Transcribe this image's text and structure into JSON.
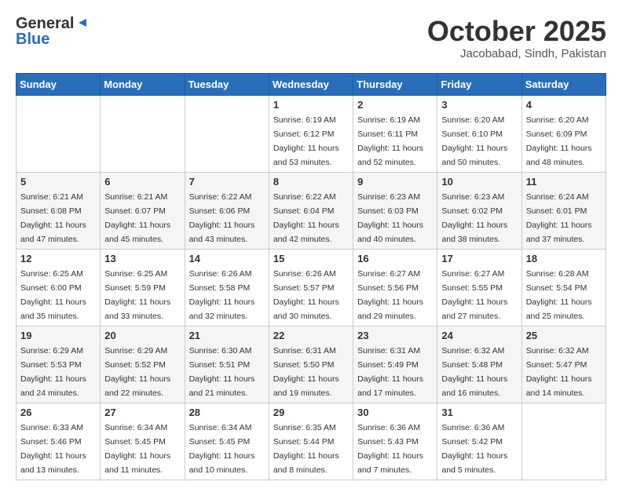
{
  "header": {
    "logo_general": "General",
    "logo_blue": "Blue",
    "month_title": "October 2025",
    "location": "Jacobabad, Sindh, Pakistan"
  },
  "weekdays": [
    "Sunday",
    "Monday",
    "Tuesday",
    "Wednesday",
    "Thursday",
    "Friday",
    "Saturday"
  ],
  "weeks": [
    [
      {
        "day": "",
        "info": ""
      },
      {
        "day": "",
        "info": ""
      },
      {
        "day": "",
        "info": ""
      },
      {
        "day": "1",
        "info": "Sunrise: 6:19 AM\nSunset: 6:12 PM\nDaylight: 11 hours\nand 53 minutes."
      },
      {
        "day": "2",
        "info": "Sunrise: 6:19 AM\nSunset: 6:11 PM\nDaylight: 11 hours\nand 52 minutes."
      },
      {
        "day": "3",
        "info": "Sunrise: 6:20 AM\nSunset: 6:10 PM\nDaylight: 11 hours\nand 50 minutes."
      },
      {
        "day": "4",
        "info": "Sunrise: 6:20 AM\nSunset: 6:09 PM\nDaylight: 11 hours\nand 48 minutes."
      }
    ],
    [
      {
        "day": "5",
        "info": "Sunrise: 6:21 AM\nSunset: 6:08 PM\nDaylight: 11 hours\nand 47 minutes."
      },
      {
        "day": "6",
        "info": "Sunrise: 6:21 AM\nSunset: 6:07 PM\nDaylight: 11 hours\nand 45 minutes."
      },
      {
        "day": "7",
        "info": "Sunrise: 6:22 AM\nSunset: 6:06 PM\nDaylight: 11 hours\nand 43 minutes."
      },
      {
        "day": "8",
        "info": "Sunrise: 6:22 AM\nSunset: 6:04 PM\nDaylight: 11 hours\nand 42 minutes."
      },
      {
        "day": "9",
        "info": "Sunrise: 6:23 AM\nSunset: 6:03 PM\nDaylight: 11 hours\nand 40 minutes."
      },
      {
        "day": "10",
        "info": "Sunrise: 6:23 AM\nSunset: 6:02 PM\nDaylight: 11 hours\nand 38 minutes."
      },
      {
        "day": "11",
        "info": "Sunrise: 6:24 AM\nSunset: 6:01 PM\nDaylight: 11 hours\nand 37 minutes."
      }
    ],
    [
      {
        "day": "12",
        "info": "Sunrise: 6:25 AM\nSunset: 6:00 PM\nDaylight: 11 hours\nand 35 minutes."
      },
      {
        "day": "13",
        "info": "Sunrise: 6:25 AM\nSunset: 5:59 PM\nDaylight: 11 hours\nand 33 minutes."
      },
      {
        "day": "14",
        "info": "Sunrise: 6:26 AM\nSunset: 5:58 PM\nDaylight: 11 hours\nand 32 minutes."
      },
      {
        "day": "15",
        "info": "Sunrise: 6:26 AM\nSunset: 5:57 PM\nDaylight: 11 hours\nand 30 minutes."
      },
      {
        "day": "16",
        "info": "Sunrise: 6:27 AM\nSunset: 5:56 PM\nDaylight: 11 hours\nand 29 minutes."
      },
      {
        "day": "17",
        "info": "Sunrise: 6:27 AM\nSunset: 5:55 PM\nDaylight: 11 hours\nand 27 minutes."
      },
      {
        "day": "18",
        "info": "Sunrise: 6:28 AM\nSunset: 5:54 PM\nDaylight: 11 hours\nand 25 minutes."
      }
    ],
    [
      {
        "day": "19",
        "info": "Sunrise: 6:29 AM\nSunset: 5:53 PM\nDaylight: 11 hours\nand 24 minutes."
      },
      {
        "day": "20",
        "info": "Sunrise: 6:29 AM\nSunset: 5:52 PM\nDaylight: 11 hours\nand 22 minutes."
      },
      {
        "day": "21",
        "info": "Sunrise: 6:30 AM\nSunset: 5:51 PM\nDaylight: 11 hours\nand 21 minutes."
      },
      {
        "day": "22",
        "info": "Sunrise: 6:31 AM\nSunset: 5:50 PM\nDaylight: 11 hours\nand 19 minutes."
      },
      {
        "day": "23",
        "info": "Sunrise: 6:31 AM\nSunset: 5:49 PM\nDaylight: 11 hours\nand 17 minutes."
      },
      {
        "day": "24",
        "info": "Sunrise: 6:32 AM\nSunset: 5:48 PM\nDaylight: 11 hours\nand 16 minutes."
      },
      {
        "day": "25",
        "info": "Sunrise: 6:32 AM\nSunset: 5:47 PM\nDaylight: 11 hours\nand 14 minutes."
      }
    ],
    [
      {
        "day": "26",
        "info": "Sunrise: 6:33 AM\nSunset: 5:46 PM\nDaylight: 11 hours\nand 13 minutes."
      },
      {
        "day": "27",
        "info": "Sunrise: 6:34 AM\nSunset: 5:45 PM\nDaylight: 11 hours\nand 11 minutes."
      },
      {
        "day": "28",
        "info": "Sunrise: 6:34 AM\nSunset: 5:45 PM\nDaylight: 11 hours\nand 10 minutes."
      },
      {
        "day": "29",
        "info": "Sunrise: 6:35 AM\nSunset: 5:44 PM\nDaylight: 11 hours\nand 8 minutes."
      },
      {
        "day": "30",
        "info": "Sunrise: 6:36 AM\nSunset: 5:43 PM\nDaylight: 11 hours\nand 7 minutes."
      },
      {
        "day": "31",
        "info": "Sunrise: 6:36 AM\nSunset: 5:42 PM\nDaylight: 11 hours\nand 5 minutes."
      },
      {
        "day": "",
        "info": ""
      }
    ]
  ]
}
